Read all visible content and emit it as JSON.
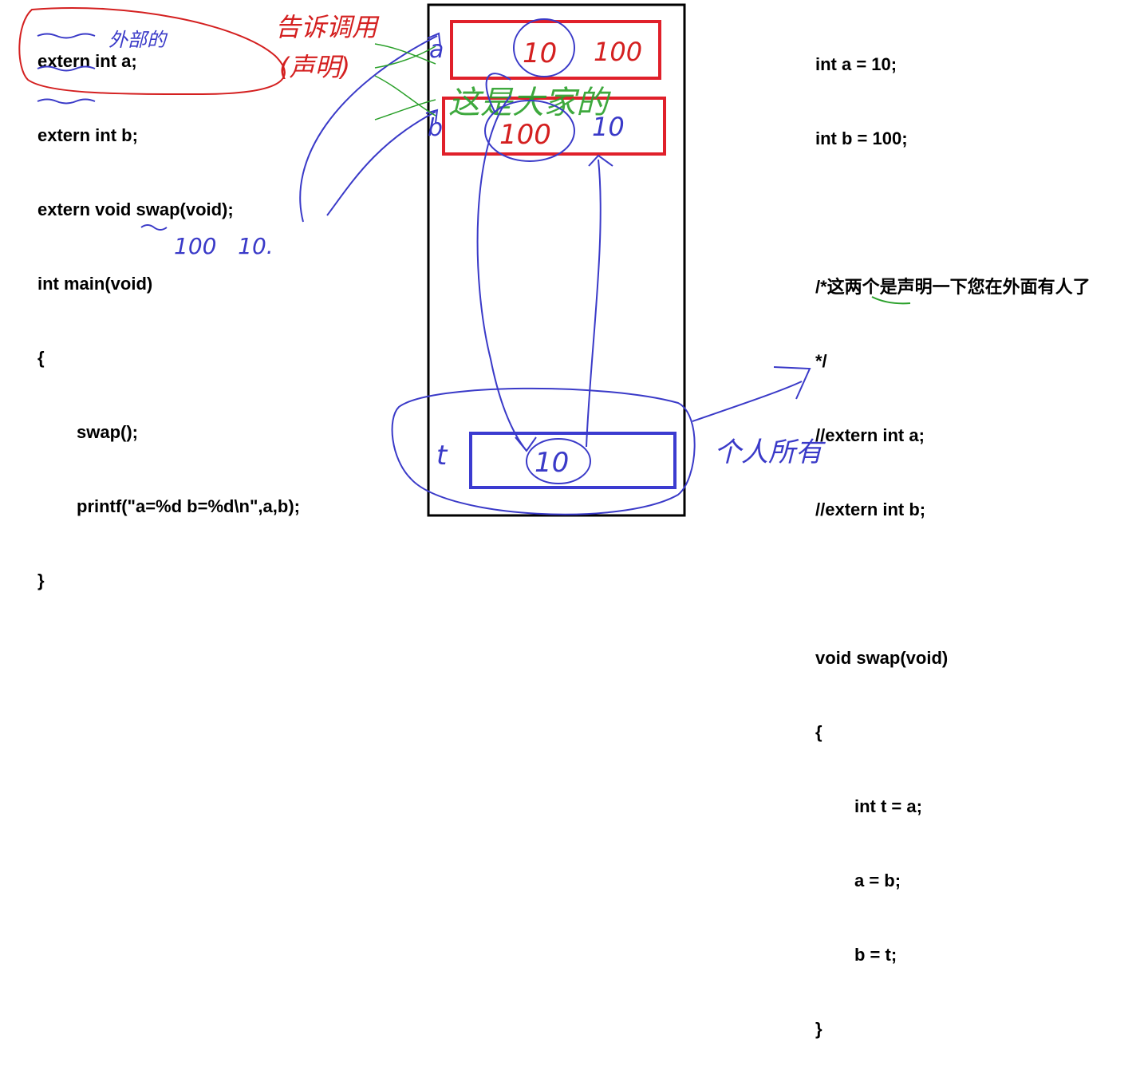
{
  "left_code": {
    "lines": [
      "extern int a;",
      "extern int b;",
      "extern void swap(void);",
      "int main(void)",
      "{",
      "swap();",
      "printf(\"a=%d b=%d\\n\",a,b);",
      "}"
    ]
  },
  "right_code": {
    "lines": [
      "int a = 10;",
      "int b = 100;",
      "",
      "/*这两个是声明一下您在外面有人了",
      "*/",
      "//extern int a;",
      "//extern int b;",
      "",
      "void swap(void)",
      "{",
      "int t = a;",
      "a = b;",
      "b = t;",
      "}"
    ]
  },
  "annotations": {
    "external": "外部的",
    "declare_ref": "告诉调用",
    "declaration": "(声明)",
    "shared": "这是大家的",
    "personal": "个人所有",
    "output": "100   10.",
    "var_a": "a",
    "var_b": "b",
    "var_t": "t"
  },
  "memory": {
    "a_old": "10",
    "a_new": "100",
    "b_old": "100",
    "b_new": "10",
    "t_val": "10"
  },
  "colors": {
    "frame": "#000000",
    "global_box": "#e0202a",
    "local_box": "#3b3bd0",
    "ink_blue": "#3a3ac8",
    "ink_red": "#d42020",
    "ink_green": "#2aa02a"
  }
}
